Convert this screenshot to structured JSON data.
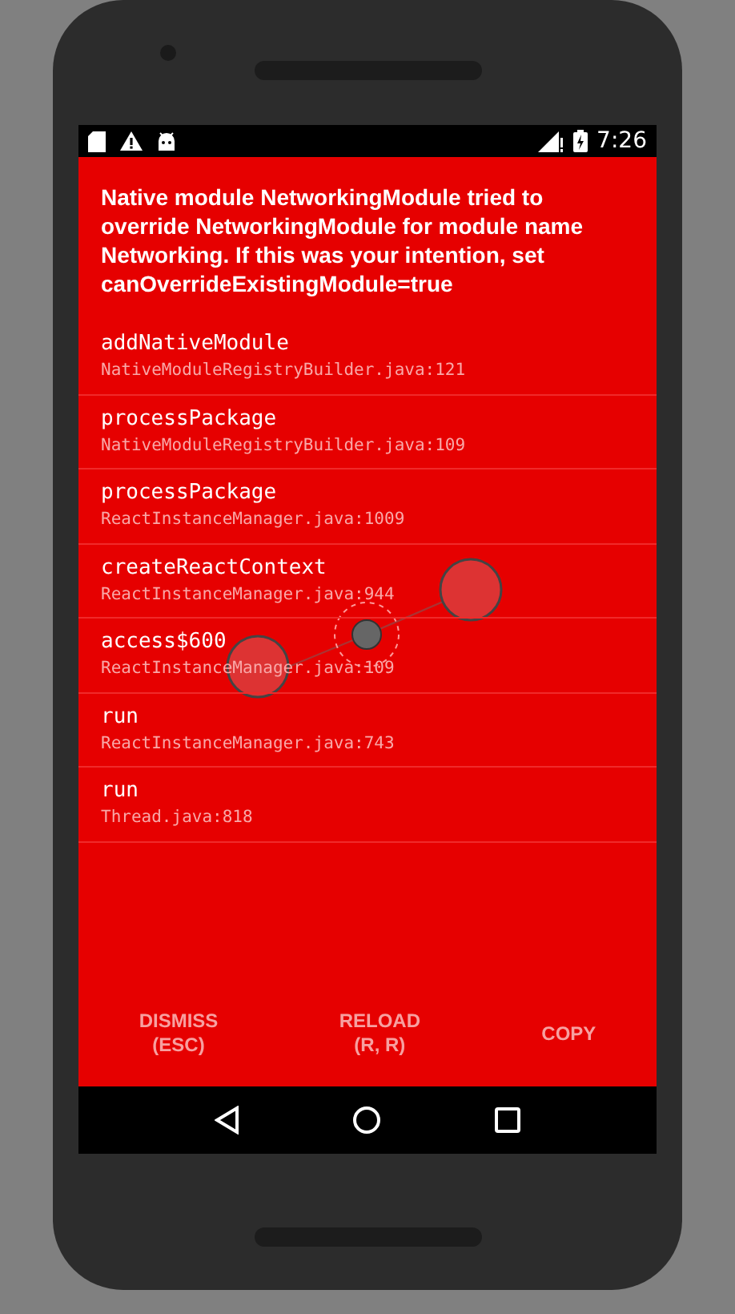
{
  "status_bar": {
    "time": "7:26"
  },
  "error": {
    "message": "Native module NetworkingModule tried to override NetworkingModule for module name Networking. If this was your intention, set canOverrideExistingModule=true"
  },
  "stack_frames": [
    {
      "method": "addNativeModule",
      "location": "NativeModuleRegistryBuilder.java:121"
    },
    {
      "method": "processPackage",
      "location": "NativeModuleRegistryBuilder.java:109"
    },
    {
      "method": "processPackage",
      "location": "ReactInstanceManager.java:1009"
    },
    {
      "method": "createReactContext",
      "location": "ReactInstanceManager.java:944"
    },
    {
      "method": "access$600",
      "location": "ReactInstanceManager.java:109"
    },
    {
      "method": "run",
      "location": "ReactInstanceManager.java:743"
    },
    {
      "method": "run",
      "location": "Thread.java:818"
    }
  ],
  "buttons": [
    "DISMISS\n(ESC)",
    "RELOAD\n(R, R)",
    "COPY"
  ]
}
